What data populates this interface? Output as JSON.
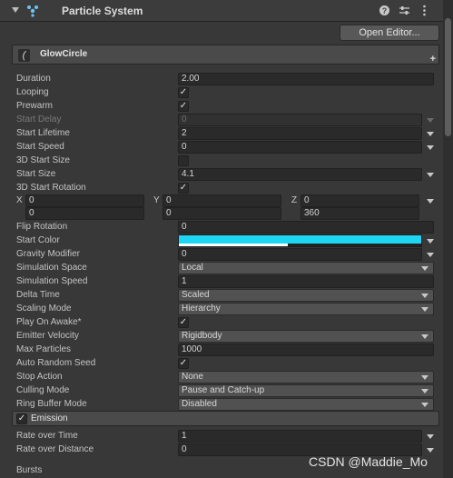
{
  "header": {
    "title": "Particle System"
  },
  "open_editor_label": "Open Editor...",
  "module": {
    "name": "GlowCircle",
    "icon_glyph": "(",
    "add_glyph": "+"
  },
  "props": {
    "duration": {
      "label": "Duration",
      "value": "2.00"
    },
    "looping": {
      "label": "Looping",
      "checked": "✓"
    },
    "prewarm": {
      "label": "Prewarm",
      "checked": "✓"
    },
    "start_delay": {
      "label": "Start Delay",
      "value": "0"
    },
    "start_lifetime": {
      "label": "Start Lifetime",
      "value": "2"
    },
    "start_speed": {
      "label": "Start Speed",
      "value": "0"
    },
    "start_size_3d": {
      "label": "3D Start Size",
      "checked": ""
    },
    "start_size": {
      "label": "Start Size",
      "value": "4.1"
    },
    "start_rotation_3d": {
      "label": "3D Start Rotation",
      "checked": "✓"
    },
    "rotation": {
      "x_label": "X",
      "y_label": "Y",
      "z_label": "Z",
      "min": [
        "0",
        "0",
        "0"
      ],
      "max": [
        "0",
        "0",
        "360"
      ]
    },
    "flip_rotation": {
      "label": "Flip Rotation",
      "value": "0"
    },
    "start_color": {
      "label": "Start Color",
      "color": "#1fd6f2"
    },
    "gravity_modifier": {
      "label": "Gravity Modifier",
      "value": "0"
    },
    "simulation_space": {
      "label": "Simulation Space",
      "value": "Local"
    },
    "simulation_speed": {
      "label": "Simulation Speed",
      "value": "1"
    },
    "delta_time": {
      "label": "Delta Time",
      "value": "Scaled"
    },
    "scaling_mode": {
      "label": "Scaling Mode",
      "value": "Hierarchy"
    },
    "play_on_awake": {
      "label": "Play On Awake*",
      "checked": "✓"
    },
    "emitter_velocity": {
      "label": "Emitter Velocity",
      "value": "Rigidbody"
    },
    "max_particles": {
      "label": "Max Particles",
      "value": "1000"
    },
    "auto_random_seed": {
      "label": "Auto Random Seed",
      "checked": "✓"
    },
    "stop_action": {
      "label": "Stop Action",
      "value": "None"
    },
    "culling_mode": {
      "label": "Culling Mode",
      "value": "Pause and Catch-up"
    },
    "ring_buffer_mode": {
      "label": "Ring Buffer Mode",
      "value": "Disabled"
    }
  },
  "emission": {
    "title": "Emission",
    "checked": "✓",
    "rate_over_time": {
      "label": "Rate over Time",
      "value": "1"
    },
    "rate_over_distance": {
      "label": "Rate over Distance",
      "value": "0"
    },
    "bursts_label": "Bursts"
  },
  "watermark": "CSDN @Maddie_Mo"
}
